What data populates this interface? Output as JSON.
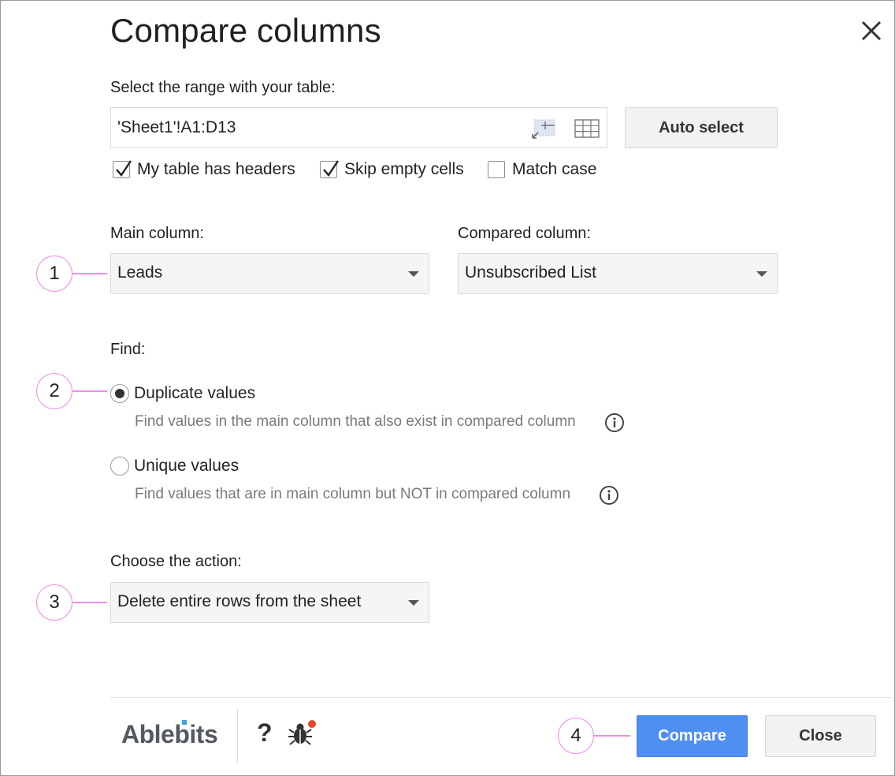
{
  "dialog": {
    "title": "Compare columns",
    "close_label": "Close dialog"
  },
  "range": {
    "label": "Select the range with your table:",
    "value": "'Sheet1'!A1:D13",
    "auto_select_label": "Auto select"
  },
  "options": {
    "headers": {
      "label": "My table has headers",
      "checked": true
    },
    "skip_empty": {
      "label": "Skip empty cells",
      "checked": true
    },
    "match_case": {
      "label": "Match case",
      "checked": false
    }
  },
  "columns": {
    "main_label": "Main column:",
    "main_value": "Leads",
    "compared_label": "Compared column:",
    "compared_value": "Unsubscribed List"
  },
  "find": {
    "label": "Find:",
    "duplicate": {
      "label": "Duplicate values",
      "description": "Find values in the main column that also exist in compared column",
      "selected": true
    },
    "unique": {
      "label": "Unique values",
      "description": "Find values that are in main column but NOT in compared column",
      "selected": false
    }
  },
  "action": {
    "label": "Choose the action:",
    "value": "Delete entire rows from the sheet"
  },
  "markers": [
    "1",
    "2",
    "3",
    "4"
  ],
  "footer": {
    "logo": "Ablebits",
    "help": "?",
    "compare_label": "Compare",
    "close_label": "Close"
  },
  "colors": {
    "accent_blue": "#4f8ff0",
    "marker_pink": "#ee8ee8",
    "notification_red": "#e8462f",
    "logo_dot_blue": "#3aa6e0"
  },
  "icons": [
    "close-icon",
    "range-select-icon",
    "table-grid-icon",
    "checkmark-icon",
    "dropdown-caret-icon",
    "info-icon",
    "help-icon",
    "bug-report-icon"
  ]
}
